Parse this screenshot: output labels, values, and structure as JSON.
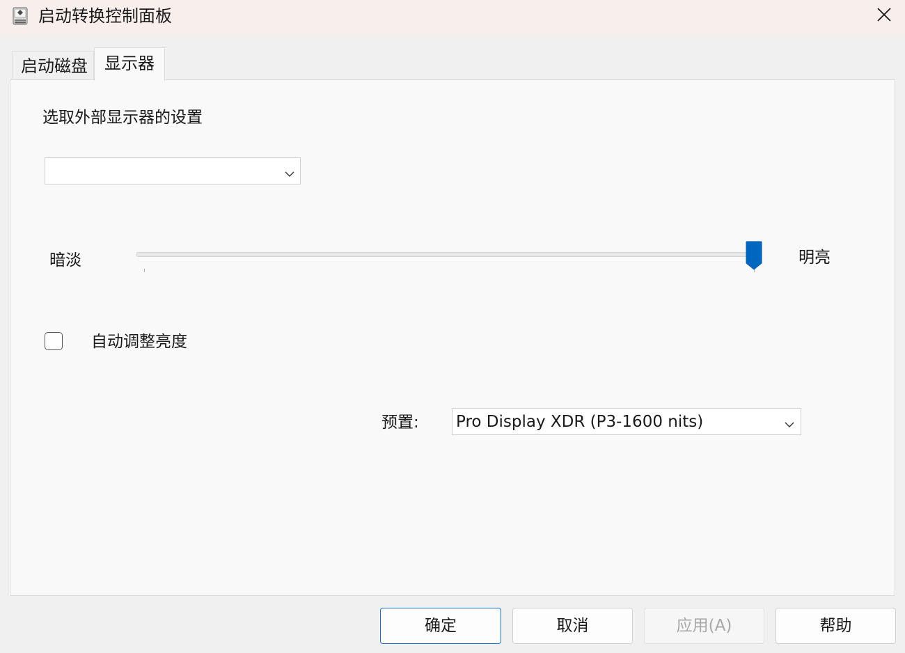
{
  "window": {
    "title": "启动转换控制面板",
    "close_symbol": "✕"
  },
  "tabs": [
    {
      "label": "启动磁盘",
      "selected": false
    },
    {
      "label": "显示器",
      "selected": true
    }
  ],
  "display": {
    "section_label": "选取外部显示器的设置",
    "monitor_select_value": "",
    "brightness": {
      "min_label": "暗淡",
      "max_label": "明亮",
      "value_fraction": 0.99
    },
    "auto_brightness": {
      "label": "自动调整亮度",
      "checked": false
    },
    "preset": {
      "label": "预置:",
      "value": "Pro Display XDR (P3-1600 nits)"
    }
  },
  "buttons": {
    "ok": "确定",
    "cancel": "取消",
    "apply": "应用(A)",
    "help": "帮助"
  },
  "colors": {
    "accent": "#0067c0",
    "titlebar_bg": "#f8efec",
    "panel_bg": "#f9f9f9",
    "window_bg": "#f0f0f0"
  },
  "icons": {
    "app": "bootcamp-disk-icon",
    "close": "close-icon",
    "dropdown": "chevron-down-icon"
  }
}
